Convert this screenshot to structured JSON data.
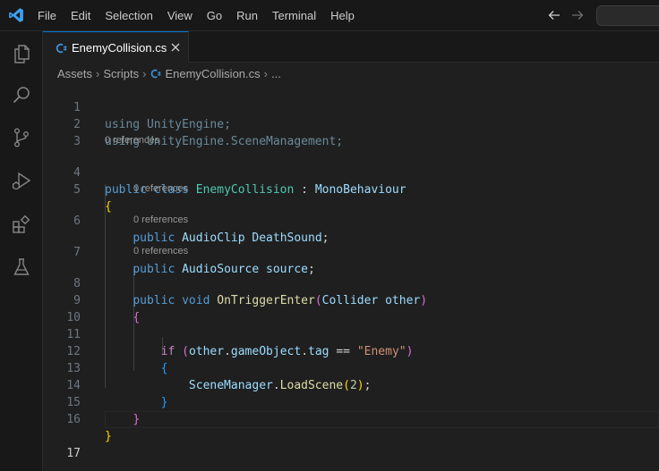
{
  "menu": [
    "File",
    "Edit",
    "Selection",
    "View",
    "Go",
    "Run",
    "Terminal",
    "Help"
  ],
  "tab": {
    "label": "EnemyCollision.cs"
  },
  "breadcrumb": {
    "folder1": "Assets",
    "folder2": "Scripts",
    "file": "EnemyCollision.cs",
    "more": "..."
  },
  "lens": {
    "refs": "0 references"
  },
  "code": {
    "using1_kw": "using",
    "using1_ns": "UnityEngine",
    "semi": ";",
    "using2_kw": "using",
    "using2_ns1": "UnityEngine",
    "dot": ".",
    "using2_ns2": "SceneManagement",
    "public": "public",
    "class": "class",
    "class_name": "EnemyCollision",
    "colon": ":",
    "base": "MonoBehaviour",
    "open_brace": "{",
    "close_brace": "}",
    "audioclip": "AudioClip",
    "deathsound": "DeathSound",
    "audiosource": "AudioSource",
    "source": "source",
    "void": "void",
    "method": "OnTriggerEnter",
    "lparen": "(",
    "rparen": ")",
    "collider": "Collider",
    "other": "other",
    "if": "if",
    "gameobject": "gameObject",
    "tag": "tag",
    "eq": "==",
    "enemy_str": "\"Enemy\"",
    "scenemanager": "SceneManager",
    "loadscene": "LoadScene",
    "scene_index": "2"
  },
  "line_numbers": [
    "1",
    "2",
    "3",
    "4",
    "5",
    "6",
    "7",
    "8",
    "9",
    "10",
    "11",
    "12",
    "13",
    "14",
    "15",
    "16",
    "17"
  ]
}
